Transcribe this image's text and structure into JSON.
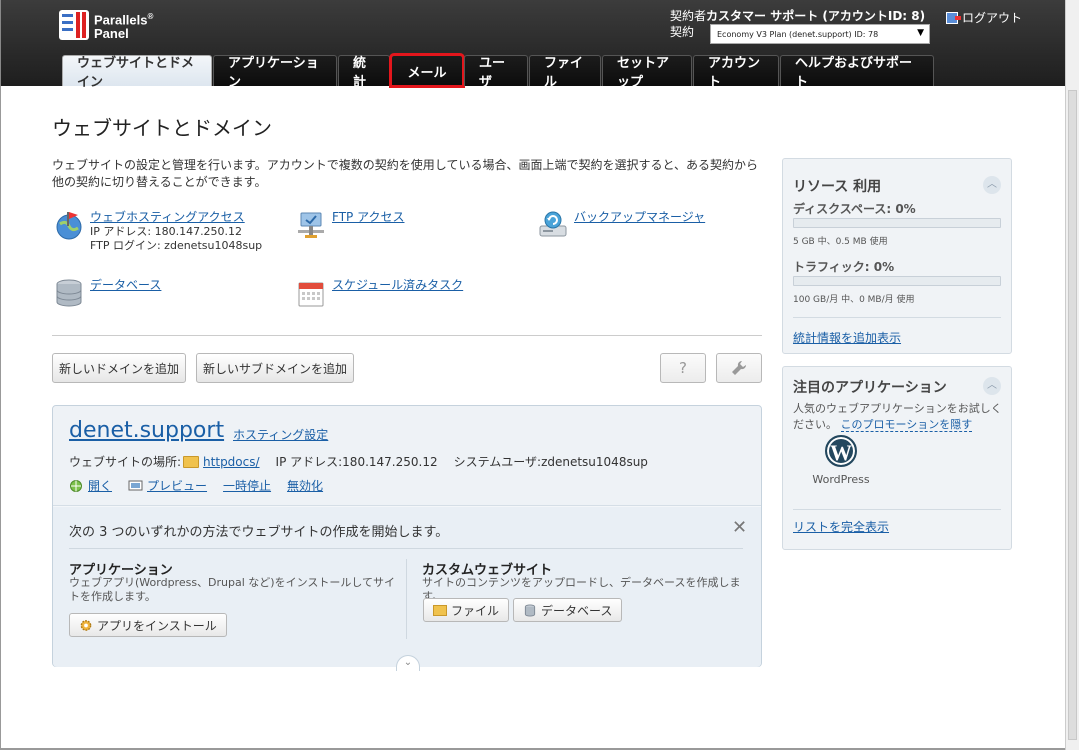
{
  "brand": {
    "line1": "Parallels",
    "mark": "®",
    "line2": "Panel"
  },
  "account": {
    "label_owner": "契約者",
    "owner_name": "カスタマー サポート (アカウントID: 8)",
    "label_subscription": "契約",
    "subscription_value": "Economy V3 Plan (denet.support) ID: 78",
    "logout": "ログアウト"
  },
  "tabs": [
    {
      "label": "ウェブサイトとドメイン",
      "active": true
    },
    {
      "label": "アプリケーション"
    },
    {
      "label": "統計"
    },
    {
      "label": "メール",
      "highlight": true
    },
    {
      "label": "ユーザ"
    },
    {
      "label": "ファイル"
    },
    {
      "label": "セットアップ"
    },
    {
      "label": "アカウント"
    },
    {
      "label": "ヘルプおよびサポート"
    }
  ],
  "page": {
    "title": "ウェブサイトとドメイン",
    "intro": "ウェブサイトの設定と管理を行います。アカウントで複数の契約を使用している場合、画面上端で契約を選択すると、ある契約から他の契約に切り替えることができます。"
  },
  "quick": {
    "hosting": {
      "link": "ウェブホスティングアクセス",
      "ip": "IP アドレス: 180.147.250.12",
      "ftp_login": "FTP ログイン: zdenetsu1048sup"
    },
    "ftp": {
      "link": "FTP アクセス"
    },
    "backup": {
      "link": "バックアップマネージャ"
    },
    "database": {
      "link": "データベース"
    },
    "tasks": {
      "link": "スケジュール済みタスク"
    }
  },
  "toolbar": {
    "add_domain": "新しいドメインを追加",
    "add_subdomain": "新しいサブドメインを追加",
    "help_symbol": "?"
  },
  "domain": {
    "name": "denet.support",
    "hosting_settings": "ホスティング設定",
    "location_label": "ウェブサイトの場所:",
    "location_value": "httpdocs/",
    "ip_label": "IP アドレス:",
    "ip_value": "180.147.250.12",
    "user_label": "システムユーザ:",
    "user_value": "zdenetsu1048sup",
    "actions": {
      "open": "開く",
      "preview": "プレビュー",
      "suspend": "一時停止",
      "disable": "無効化"
    }
  },
  "start": {
    "title": "次の 3 つのいずれかの方法でウェブサイトの作成を開始します。",
    "close": "✕",
    "apps": {
      "title": "アプリケーション",
      "desc": "ウェブアプリ(Wordpress、Drupal など)をインストールしてサイトを作成します。",
      "button": "アプリをインストール"
    },
    "custom": {
      "title": "カスタムウェブサイト",
      "desc": "サイトのコンテンツをアップロードし、データベースを作成します。",
      "files_button": "ファイル",
      "db_button": "データベース"
    }
  },
  "sidebar": {
    "resources": {
      "title": "リソース 利用",
      "disk_label": "ディスクスペース: 0%",
      "disk_usage": 0,
      "disk_sub": "5 GB 中、0.5 MB 使用",
      "traffic_label": "トラフィック: 0%",
      "traffic_usage": 0,
      "traffic_sub": "100 GB/月 中、0 MB/月 使用",
      "more_stats": "統計情報を追加表示"
    },
    "featured": {
      "title": "注目のアプリケーション",
      "desc": "人気のウェブアプリケーションをお試しください。",
      "hide_promo": "このプロモーションを隠す",
      "app_name": "WordPress",
      "show_all": "リストを完全表示"
    }
  },
  "colors": {
    "header_bg": "#2a2a2a",
    "highlight": "#e3161c",
    "link": "#1a5fa6"
  }
}
